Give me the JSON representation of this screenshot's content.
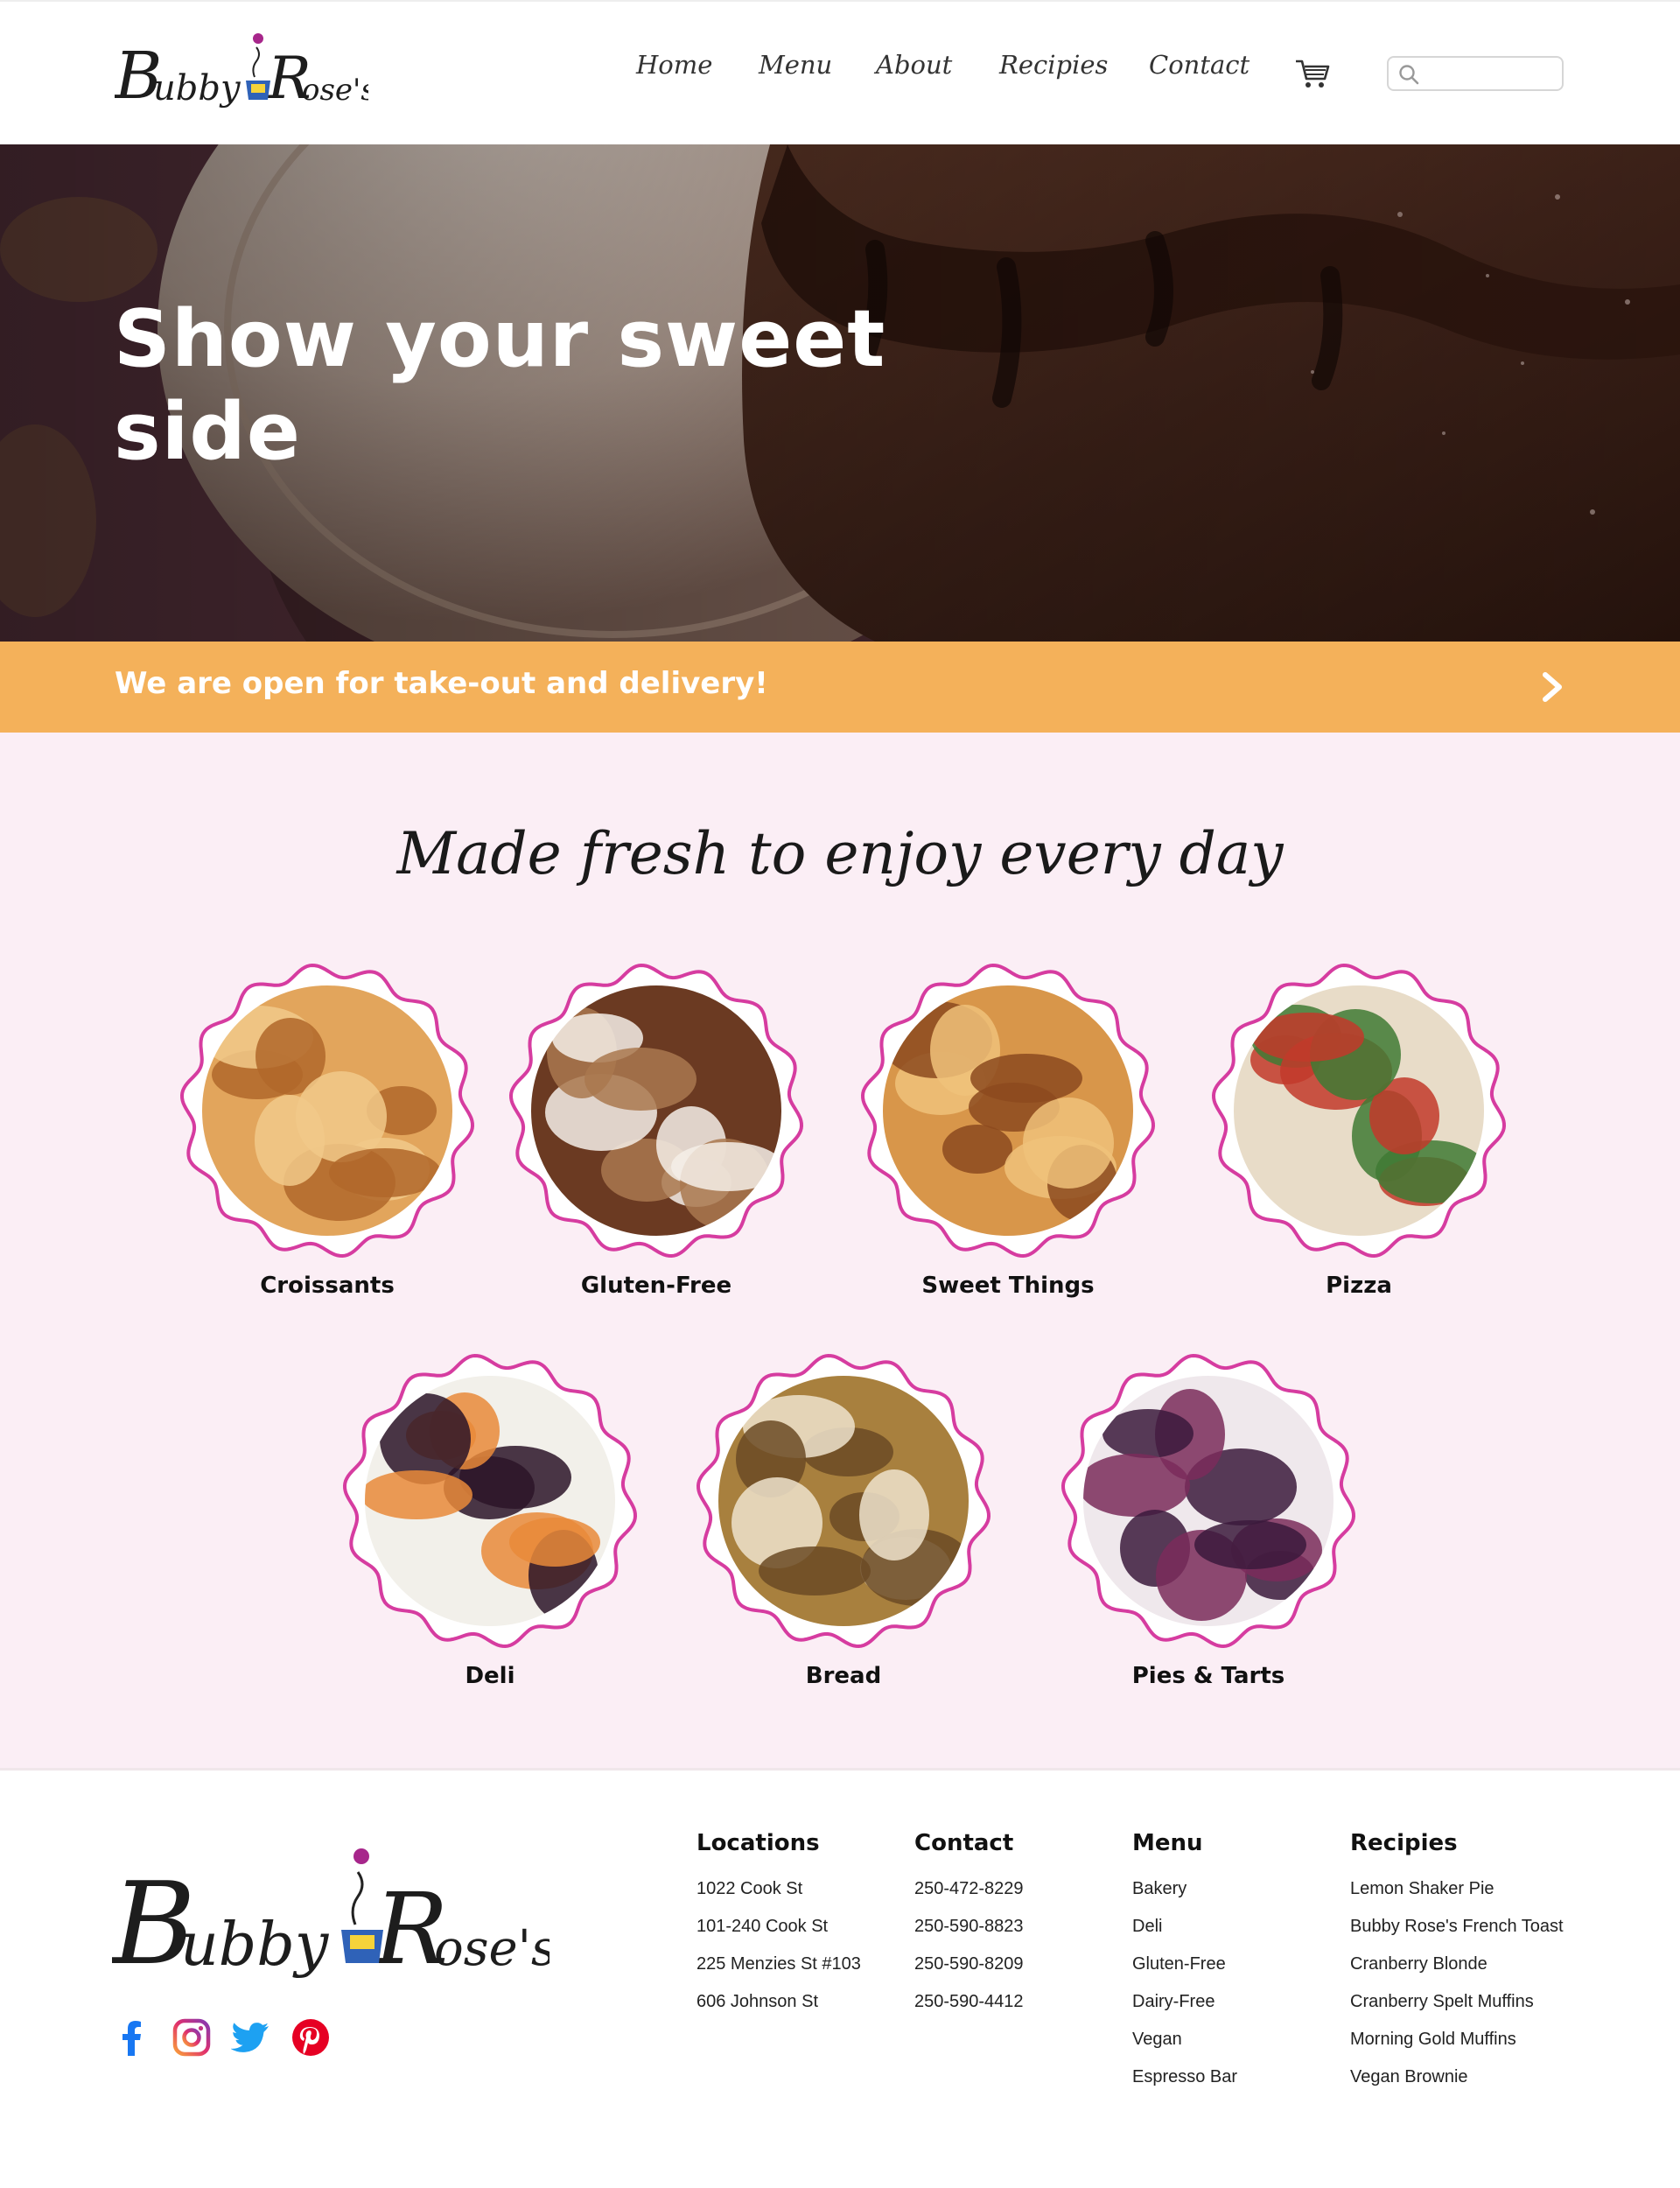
{
  "brand": {
    "name": "Bubby Rose's",
    "logo_left": "Bubby",
    "logo_right": "Rose's"
  },
  "nav": {
    "items": [
      "Home",
      "Menu",
      "About",
      "Recipies",
      "Contact"
    ],
    "cart_icon": "cart-icon",
    "search_placeholder": ""
  },
  "hero": {
    "title": "Show your sweet side"
  },
  "banner": {
    "text": "We are open for take-out and delivery!",
    "arrow_icon": "chevron-right-icon"
  },
  "menu": {
    "title": "Made fresh to enjoy every day",
    "border_color": "#d63ca0",
    "categories": [
      "Croissants",
      "Gluten-Free",
      "Sweet Things",
      "Pizza",
      "Deli",
      "Bread",
      "Pies & Tarts"
    ]
  },
  "footer": {
    "locations": {
      "title": "Locations",
      "items": [
        "1022 Cook St",
        "101-240 Cook St",
        "225 Menzies St #103",
        "606 Johnson St"
      ]
    },
    "contact": {
      "title": "Contact",
      "items": [
        "250-472-8229",
        "250-590-8823",
        "250-590-8209",
        "250-590-4412"
      ]
    },
    "menu": {
      "title": "Menu",
      "items": [
        "Bakery",
        "Deli",
        "Gluten-Free",
        "Dairy-Free",
        "Vegan",
        "Espresso Bar"
      ]
    },
    "recipies": {
      "title": "Recipies",
      "items": [
        "Lemon Shaker Pie",
        "Bubby Rose's French Toast",
        "Cranberry Blonde",
        "Cranberry Spelt Muffins",
        "Morning Gold Muffins",
        "Vegan Brownie"
      ]
    },
    "social": [
      "facebook-icon",
      "instagram-icon",
      "twitter-icon",
      "pinterest-icon"
    ]
  },
  "colors": {
    "banner": "#f4b15a",
    "section_bg": "#fbeef5",
    "accent": "#d63ca0"
  }
}
